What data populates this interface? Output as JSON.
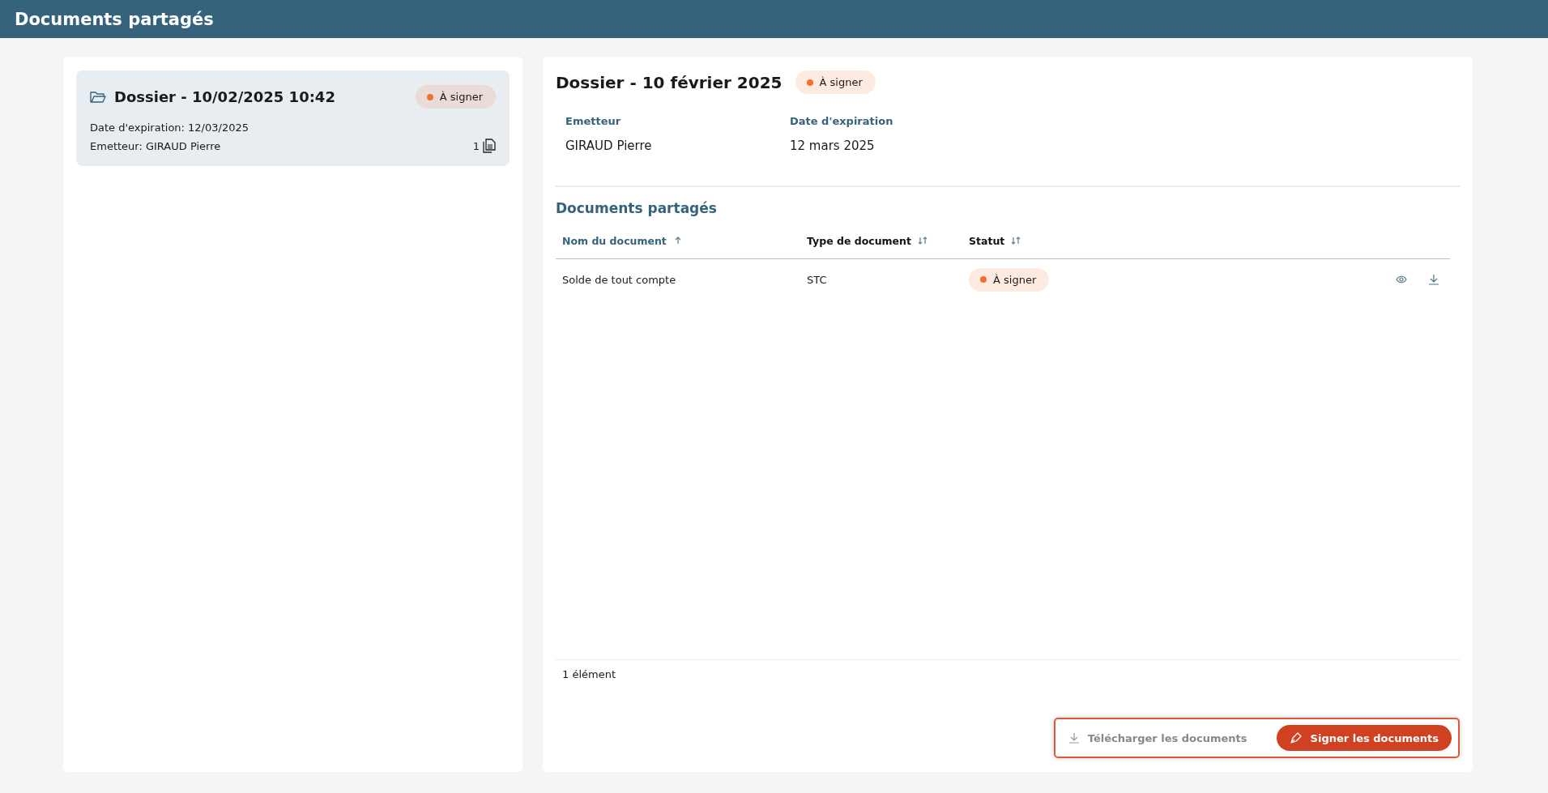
{
  "header": {
    "title": "Documents partagés"
  },
  "folders": [
    {
      "title": "Dossier - 10/02/2025 10:42",
      "status": "À signer",
      "color": "#f07030",
      "expiration": "Date d'expiration: 12/03/2025",
      "issuer": "Emetteur: GIRAUD Pierre",
      "count": "1",
      "selected": true
    }
  ],
  "detail": {
    "title": "Dossier - 10 février 2025",
    "status": "À signer",
    "color": "#f07030",
    "fields": [
      {
        "label": "Emetteur",
        "value": "GIRAUD Pierre"
      },
      {
        "label": "Date d'expiration",
        "value": "12 mars 2025"
      }
    ],
    "section_title": "Documents partagés",
    "table": {
      "columns": [
        {
          "label": "Nom du document",
          "sorted": true
        },
        {
          "label": "Type de document",
          "sorted": false
        },
        {
          "label": "Statut",
          "sorted": false
        }
      ],
      "rows": [
        {
          "name": "Solde de tout compte",
          "type": "STC",
          "status": "À signer",
          "color": "#f07030"
        }
      ]
    },
    "footer": "1 élément",
    "actions": [
      {
        "kind": "download",
        "label": "Télécharger les documents",
        "disabled": true
      },
      {
        "kind": "sign",
        "label": "Signer les documents",
        "disabled": false
      }
    ]
  }
}
